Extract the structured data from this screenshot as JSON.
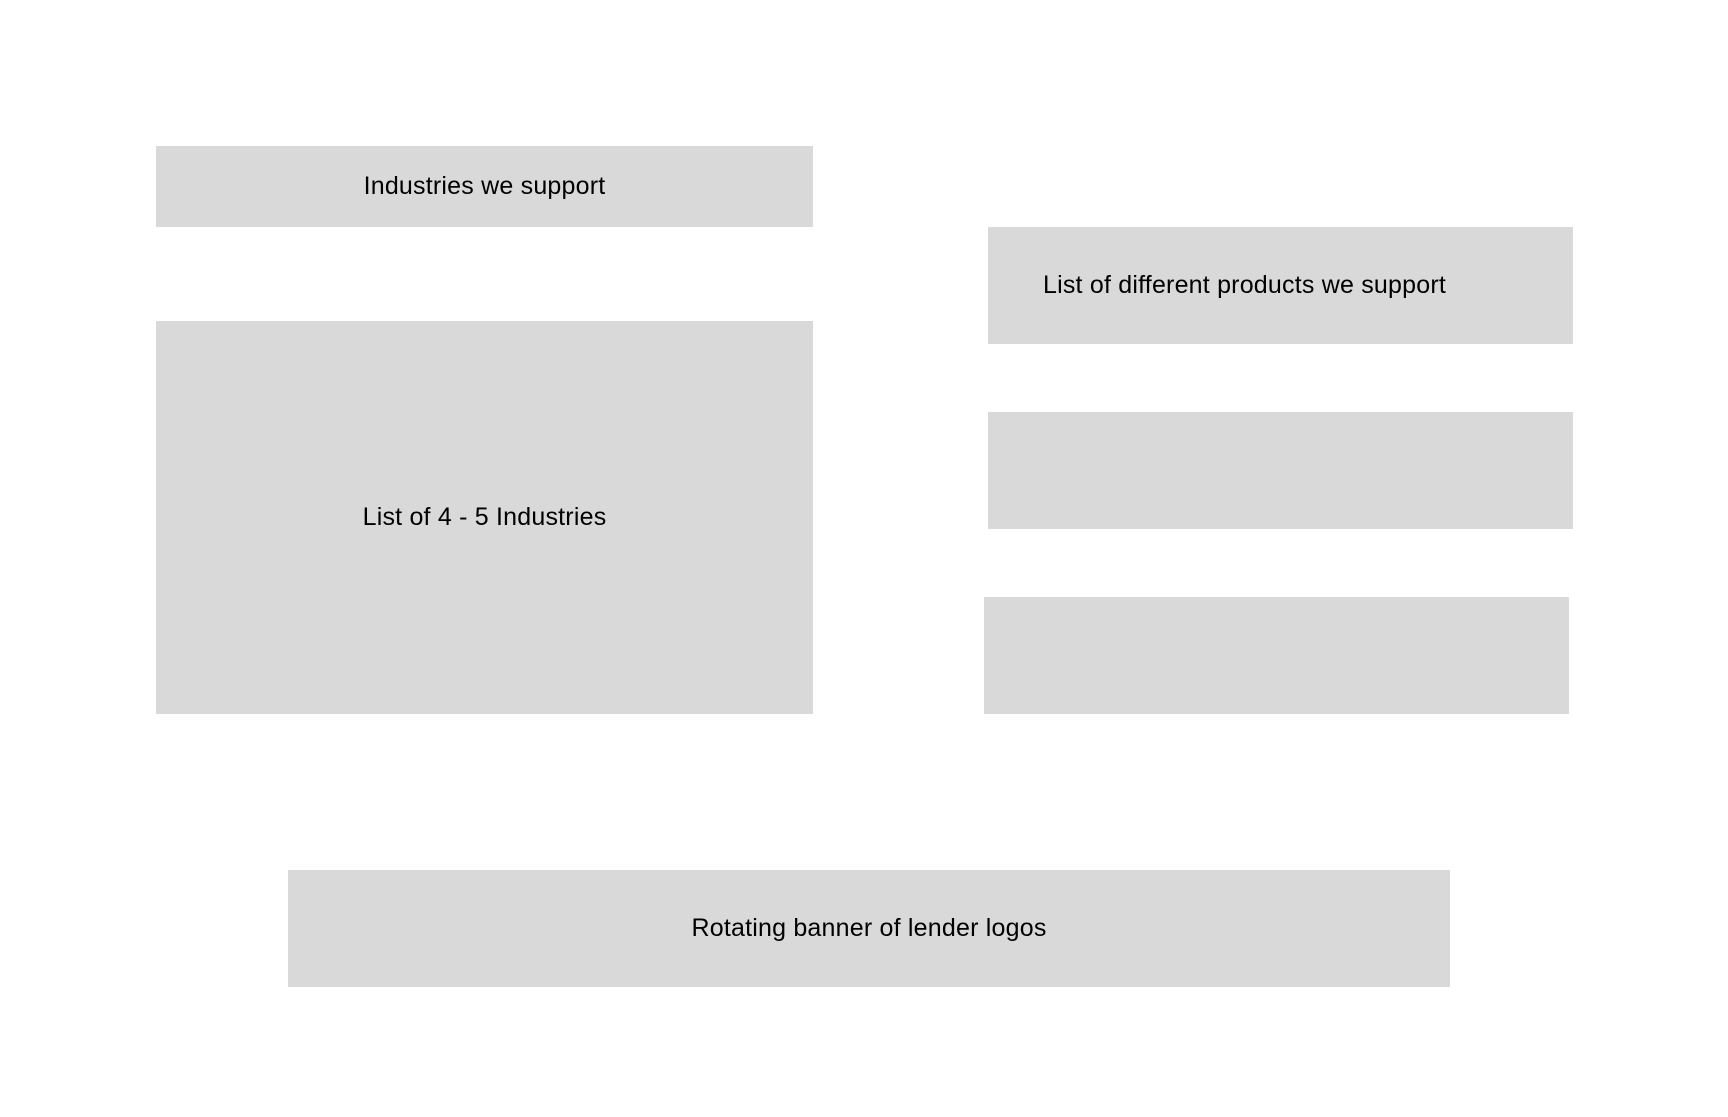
{
  "wireframe": {
    "industries_header": {
      "label": "Industries we support"
    },
    "industries_list": {
      "label": "List of 4 - 5 Industries"
    },
    "products": {
      "header_label": "List of different products we support",
      "placeholders": [
        "",
        ""
      ]
    },
    "lender_banner": {
      "label": "Rotating banner of lender logos"
    },
    "colors": {
      "background": "#ffffff",
      "block": "#d9d9d9",
      "text": "#000000"
    }
  }
}
